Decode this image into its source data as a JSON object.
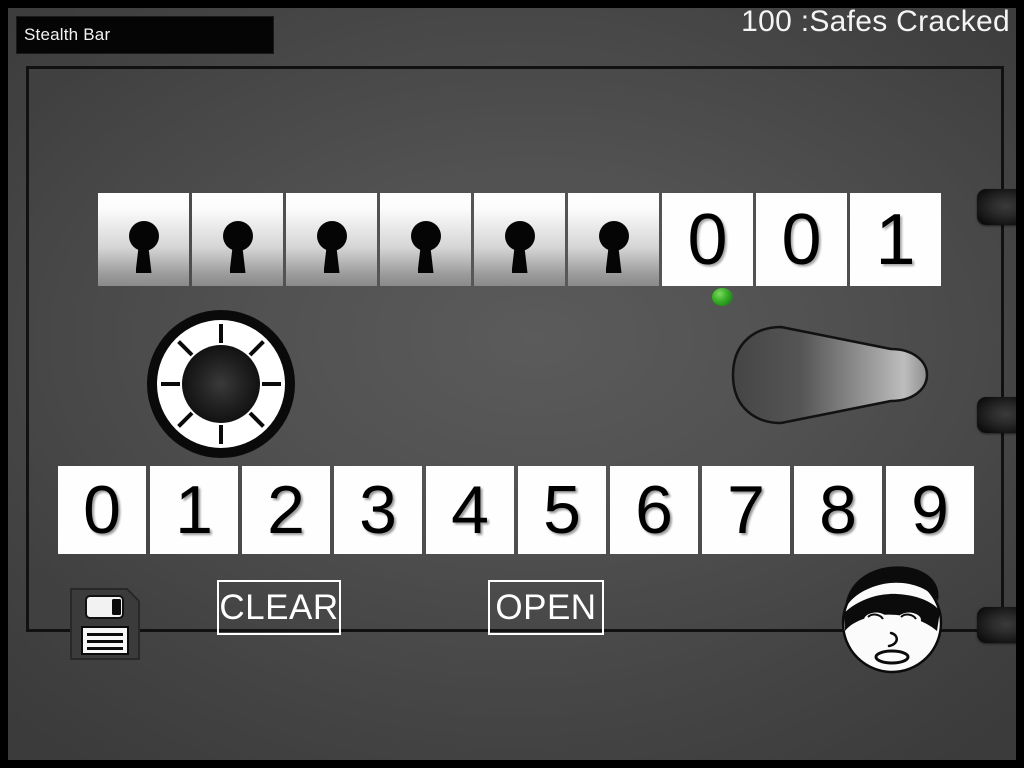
{
  "hud": {
    "stealth_bar": {
      "label": "Stealth Bar",
      "fill_percent": 0,
      "fill_color": "#1f8a2a",
      "background_color": "#050505"
    },
    "score": {
      "text": "100 :Safes Cracked",
      "value": 100,
      "caption": "Safes Cracked"
    }
  },
  "safe": {
    "display": {
      "keyholes": [
        {
          "name": "keyhole-1",
          "state": "locked"
        },
        {
          "name": "keyhole-2",
          "state": "locked"
        },
        {
          "name": "keyhole-3",
          "state": "locked"
        },
        {
          "name": "keyhole-4",
          "state": "locked"
        },
        {
          "name": "keyhole-5",
          "state": "locked"
        },
        {
          "name": "keyhole-6",
          "state": "locked"
        }
      ],
      "code_digits": [
        "0",
        "0",
        "1"
      ],
      "active_indicator": {
        "icon": "green-dot-icon",
        "color": "#3fb22c",
        "under_digit_index": 0
      }
    },
    "dial": {
      "icon": "safe-dial-icon",
      "tick_count": 8,
      "ring_color": "#ffffff",
      "hub_color": "#141414"
    },
    "handle": {
      "icon": "safe-handle-icon",
      "state": "closed"
    },
    "latches": [
      {
        "name": "latch-top"
      },
      {
        "name": "latch-middle"
      },
      {
        "name": "latch-bottom"
      }
    ],
    "keypad": {
      "keys": [
        "0",
        "1",
        "2",
        "3",
        "4",
        "5",
        "6",
        "7",
        "8",
        "9"
      ]
    },
    "actions": {
      "clear_label": "CLEAR",
      "open_label": "OPEN"
    },
    "save_button": {
      "icon": "floppy-disk-save-icon"
    },
    "avatar": {
      "icon": "burglar-face-icon",
      "name": "burglar"
    }
  },
  "theme": {
    "background": "#4e4e4e",
    "door_face": "#515151",
    "tile_white": "#fefefe",
    "text_black": "#000000",
    "text_white": "#ffffff",
    "accent_green": "#3fb22c",
    "frame_black": "#000000"
  }
}
